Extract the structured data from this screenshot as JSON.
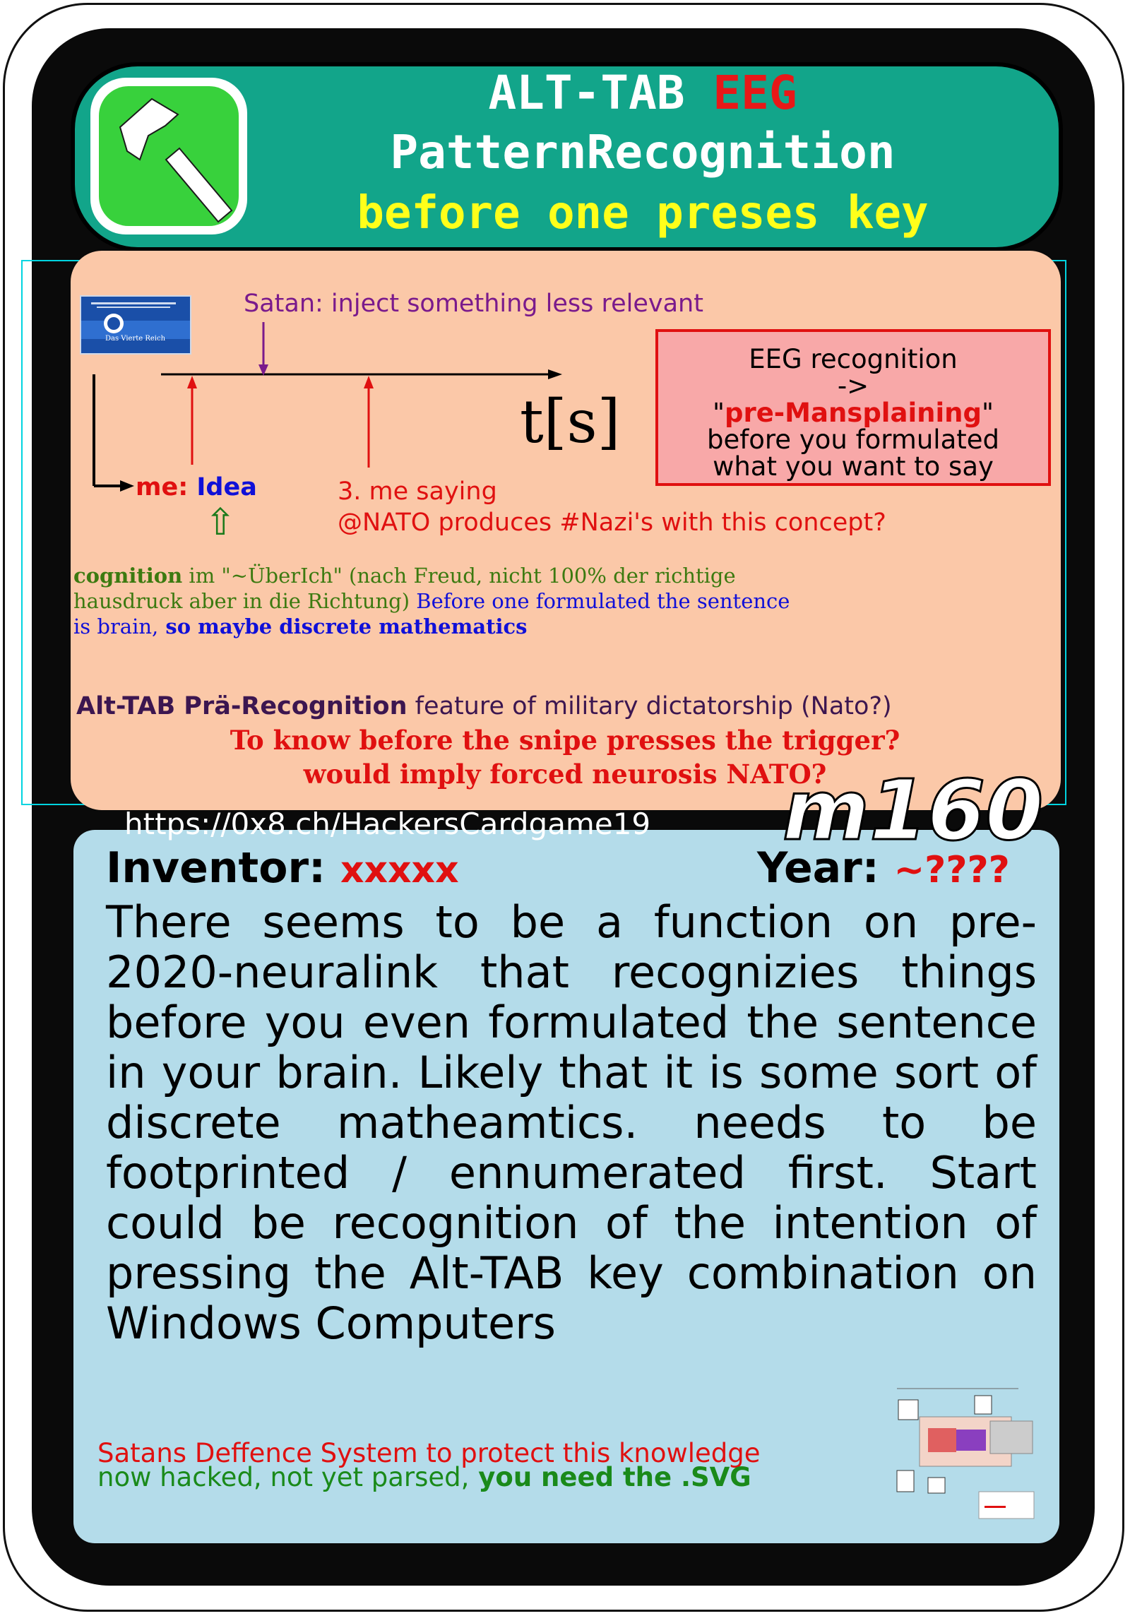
{
  "header": {
    "line1_a": "ALT-TAB",
    "line1_b": "EEG",
    "line2": "PatternRecognition",
    "line3": "before one preses key"
  },
  "diagram": {
    "flag_title": "Das Vierte Reich",
    "satan_label": "Satan: inject something less relevant",
    "axis_label": "t[s]",
    "me_prefix": "me: ",
    "me_idea": "Idea",
    "saying": "3. me saying",
    "nato_question": "@NATO produces #Nazi's with this concept?",
    "eeg_box": {
      "line1": "EEG recognition",
      "line2": "->",
      "q_open": "\"",
      "highlight": "pre-Mansplaining",
      "q_close": "\"",
      "line4": "before you formulated",
      "line5": "what you want to say"
    },
    "serif_line1_bold": "cognition",
    "serif_line1": " im \"~ÜberIch\" (nach Freud, nicht 100% der richtige",
    "serif_line2_green": "hausdruck aber in die Richtung)",
    "serif_line2_blue": " Before one formulated the sentence",
    "serif_line3_a": "is brain,",
    "serif_line3_b": " so maybe discrete mathematics",
    "alt_tab_bold": "Alt-TAB Prä-Recognition",
    "alt_tab_rest": " feature of military dictatorship (Nato?)",
    "snipe_line1": "To know before the snipe presses the trigger?",
    "snipe_line2": "would imply forced neurosis NATO?"
  },
  "card": {
    "url": "https://0x8.ch/HackersCardgame19",
    "card_id": "m160",
    "inventor_label": "Inventor:",
    "inventor_value": "xxxxx",
    "year_label": "Year:",
    "year_value": "~????",
    "description": "There seems to be a function on pre-2020-neuralink that recognizies things before you even formulated the sentence in your brain. Likely that it is some sort of discrete matheamtics. needs to be footprinted / ennumerated first. Start could be recognition of the intention of pressing the Alt-TAB key combination on Windows Computers",
    "footer_line1": "Satans Deffence System to protect this knowledge",
    "footer_line2_a": "now hacked, not yet parsed,",
    "footer_line2_b": " you need the .SVG"
  },
  "colors": {
    "header_green": "#12a58a",
    "peach": "#fbc8a8",
    "blue_panel": "#b4dcea",
    "accent_red": "#e01010",
    "title_yellow": "#ffff1a",
    "purple": "#7a1a8c"
  },
  "icons": [
    "hammer-icon",
    "up-arrow-icon",
    "timeline-arrow-icon"
  ]
}
